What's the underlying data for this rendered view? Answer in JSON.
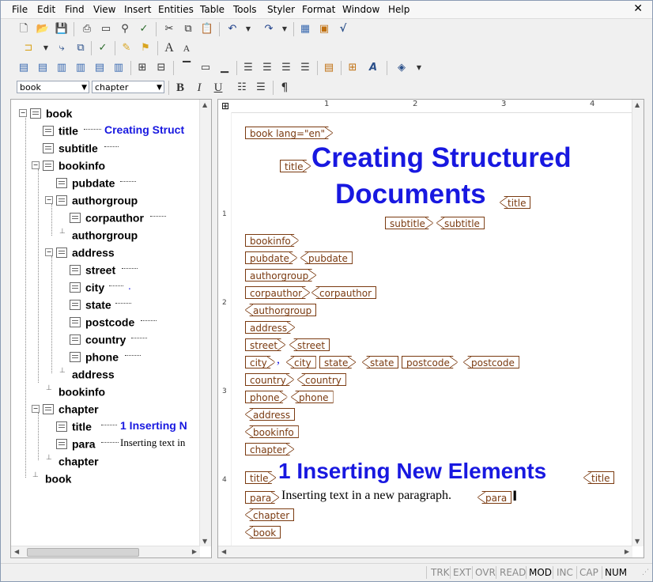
{
  "menu": [
    "File",
    "Edit",
    "Find",
    "View",
    "Insert",
    "Entities",
    "Table",
    "Tools",
    "Styler",
    "Format",
    "Window",
    "Help"
  ],
  "close_label": "✕",
  "format": {
    "style_value": "book",
    "element_value": "chapter"
  },
  "toolbar": {
    "bold": "B",
    "italic": "I",
    "underline": "U",
    "pilcrow": "¶"
  },
  "tree": {
    "nodes": [
      {
        "label": "book"
      },
      {
        "label": "title",
        "value": "Creating Struct"
      },
      {
        "label": "subtitle"
      },
      {
        "label": "bookinfo"
      },
      {
        "label": "pubdate"
      },
      {
        "label": "authorgroup"
      },
      {
        "label": "corpauthor"
      },
      {
        "label": "authorgroup"
      },
      {
        "label": "address"
      },
      {
        "label": "street"
      },
      {
        "label": "city"
      },
      {
        "label": "state"
      },
      {
        "label": "postcode"
      },
      {
        "label": "country"
      },
      {
        "label": "phone"
      },
      {
        "label": "address"
      },
      {
        "label": "bookinfo"
      },
      {
        "label": "chapter"
      },
      {
        "label": "title",
        "value": "1  Inserting N"
      },
      {
        "label": "para",
        "value": "Inserting text in"
      },
      {
        "label": "chapter"
      },
      {
        "label": "book"
      }
    ],
    "city_dot": "."
  },
  "ruler": [
    "1",
    "2",
    "3",
    "4"
  ],
  "vruler": [
    "1",
    "2",
    "3",
    "4"
  ],
  "doc": {
    "book_open": "book lang=\"en\"",
    "title": "title",
    "heading_line1": "Creating Structured",
    "heading_line2": "Documents",
    "subtitle": "subtitle",
    "bookinfo": "bookinfo",
    "pubdate": "pubdate",
    "authorgroup": "authorgroup",
    "corpauthor": "corpauthor",
    "address": "address",
    "street": "street",
    "city": "city",
    "comma": ",",
    "state": "state",
    "postcode": "postcode",
    "country": "country",
    "phone": "phone",
    "chapter": "chapter",
    "chapter_heading": "1  Inserting New Elements",
    "para": "para",
    "para_text": "Inserting text in a new paragraph.",
    "book": "book"
  },
  "status": [
    {
      "label": "TRK",
      "active": false
    },
    {
      "label": "EXT",
      "active": false
    },
    {
      "label": "OVR",
      "active": false
    },
    {
      "label": "READ",
      "active": false
    },
    {
      "label": "MOD",
      "active": true
    },
    {
      "label": "INC",
      "active": false
    },
    {
      "label": "CAP",
      "active": false
    },
    {
      "label": "NUM",
      "active": true
    }
  ]
}
